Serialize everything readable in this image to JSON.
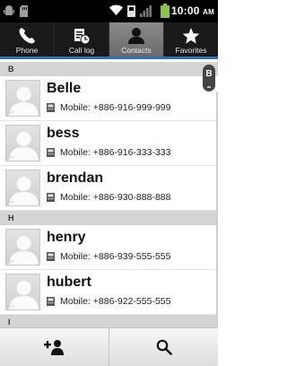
{
  "status_bar": {
    "time": "10:00",
    "ampm": "AM",
    "icons": [
      "android-debug-icon",
      "sd-card-icon",
      "wifi-icon",
      "data-icon",
      "signal-icon",
      "battery-icon"
    ]
  },
  "tabs": [
    {
      "id": "phone",
      "label": "Phone",
      "icon": "phone-icon"
    },
    {
      "id": "call-log",
      "label": "Call log",
      "icon": "call-log-icon"
    },
    {
      "id": "contacts",
      "label": "Contacts",
      "icon": "contacts-icon",
      "active": true
    },
    {
      "id": "favorites",
      "label": "Favorites",
      "icon": "star-icon"
    }
  ],
  "fast_scroll_letter": "B",
  "sections": [
    {
      "letter": "B",
      "contacts": [
        {
          "name": "Belle",
          "phone": "Mobile: +886-916-999-999"
        },
        {
          "name": "bess",
          "phone": "Mobile: +886-916-333-333"
        },
        {
          "name": "brendan",
          "phone": "Mobile: +886-930-888-888"
        }
      ]
    },
    {
      "letter": "H",
      "contacts": [
        {
          "name": "henry",
          "phone": "Mobile: +886-939-555-555"
        },
        {
          "name": "hubert",
          "phone": "Mobile: +886-922-555-555"
        }
      ]
    },
    {
      "letter": "I",
      "contacts": []
    }
  ],
  "bottom_bar": {
    "add_contact_icon": "add-contact-icon",
    "search_icon": "search-icon"
  },
  "colors": {
    "tab_underline": "#2f6fb4",
    "battery": "#8bc34a"
  }
}
